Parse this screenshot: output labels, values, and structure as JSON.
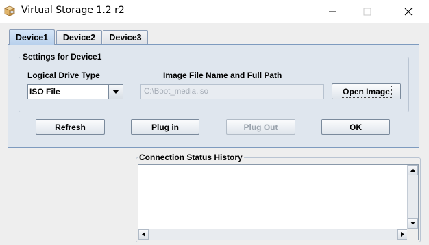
{
  "window": {
    "title": "Virtual Storage 1.2 r2",
    "icon": "package-box-icon"
  },
  "tabs": [
    {
      "label": "Device1",
      "active": true
    },
    {
      "label": "Device2",
      "active": false
    },
    {
      "label": "Device3",
      "active": false
    }
  ],
  "settings": {
    "group_title": "Settings for Device1",
    "drive_type_label": "Logical Drive Type",
    "drive_type_value": "ISO File",
    "image_path_label": "Image File Name and Full Path",
    "image_path_value": "C:\\Boot_media.iso",
    "open_image_label": "Open Image"
  },
  "actions": {
    "refresh": "Refresh",
    "plug_in": "Plug in",
    "plug_out": "Plug Out",
    "ok": "OK"
  },
  "status": {
    "title": "Connection Status History"
  },
  "colors": {
    "active_tab": "#b7d0ec",
    "panel_bg": "#dfe6ee",
    "window_bg": "#eeeeee"
  }
}
